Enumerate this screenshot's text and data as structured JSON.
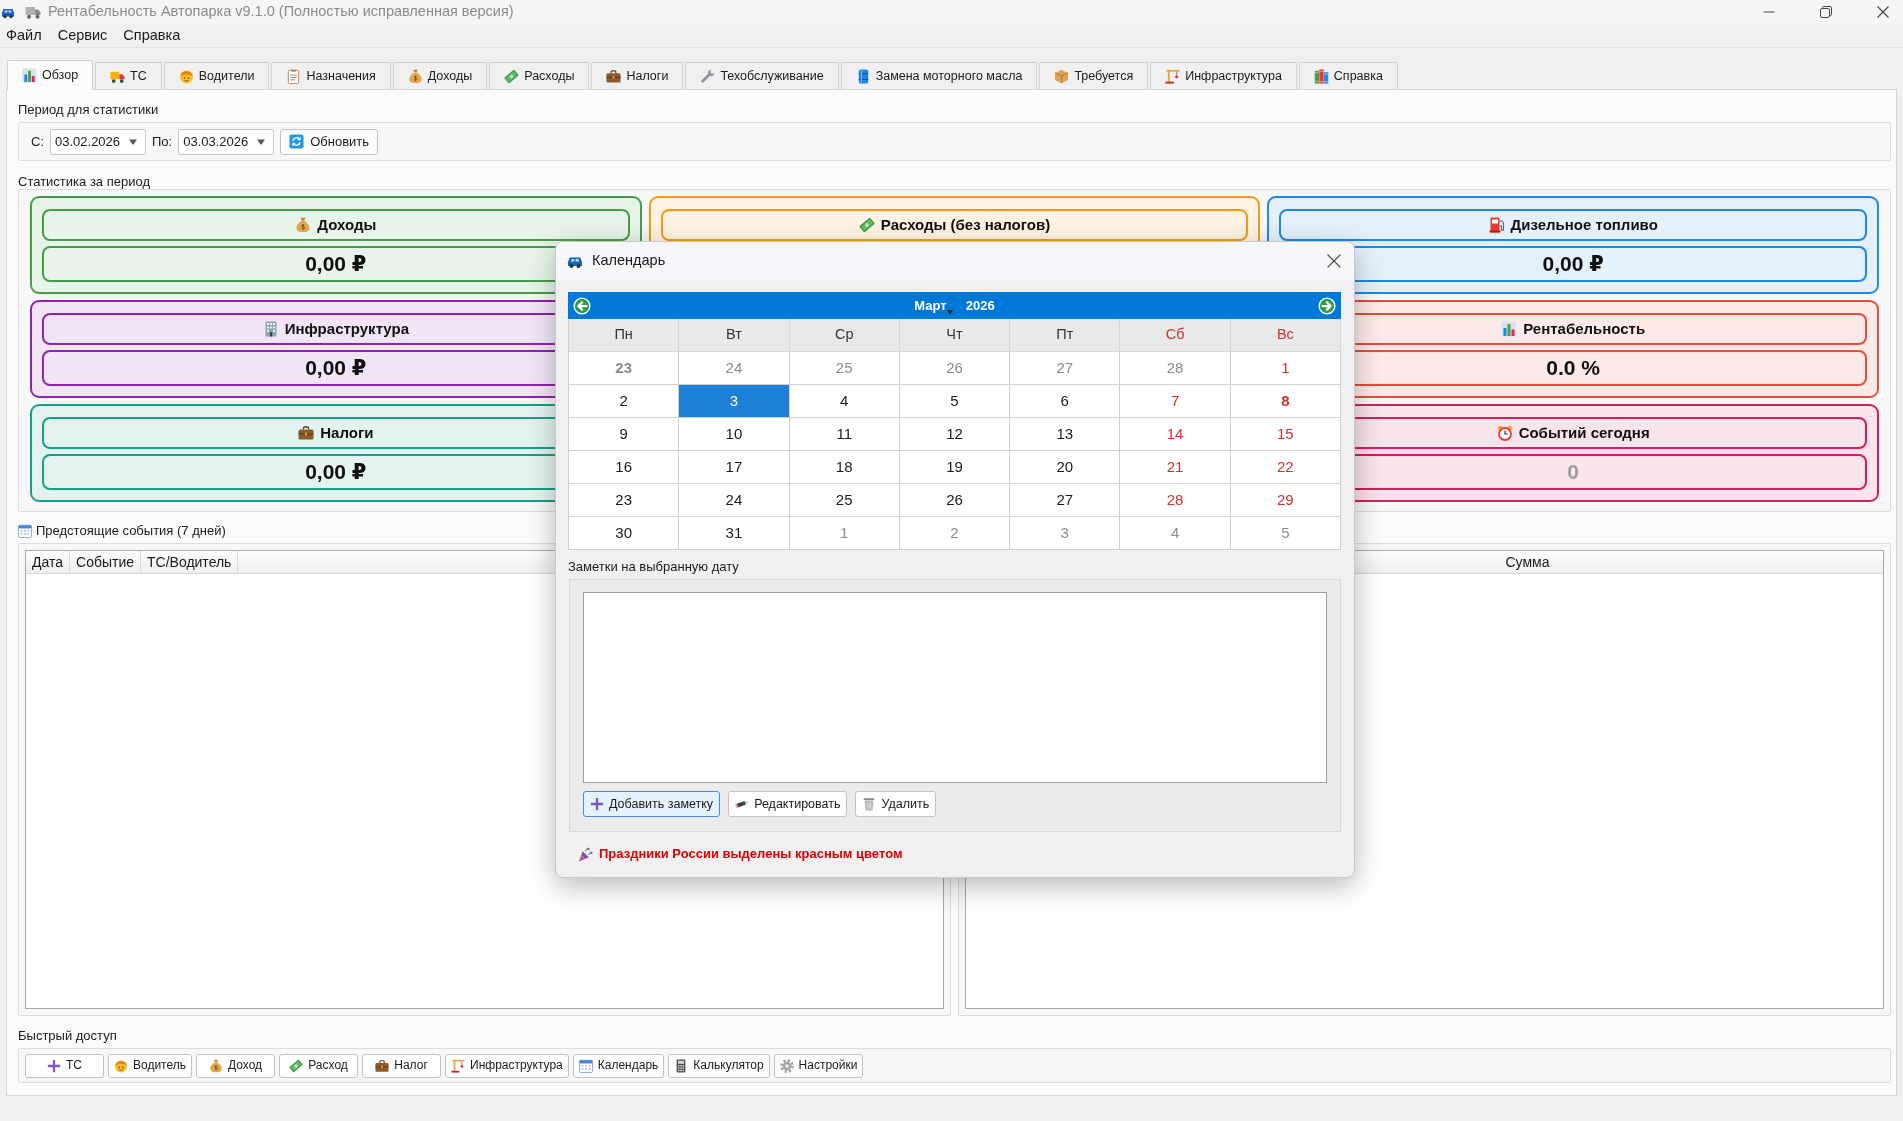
{
  "window": {
    "title": "Рентабельность Автопарка v9.1.0 (Полностью исправленная версия)"
  },
  "menu": [
    "Файл",
    "Сервис",
    "Справка"
  ],
  "tabs": [
    {
      "label": "Обзор",
      "selected": true
    },
    {
      "label": "ТС",
      "selected": false
    },
    {
      "label": "Водители",
      "selected": false
    },
    {
      "label": "Назначения",
      "selected": false
    },
    {
      "label": "Доходы",
      "selected": false
    },
    {
      "label": "Расходы",
      "selected": false
    },
    {
      "label": "Налоги",
      "selected": false
    },
    {
      "label": "Техобслуживание",
      "selected": false
    },
    {
      "label": "Замена моторного масла",
      "selected": false
    },
    {
      "label": "Требуется",
      "selected": false
    },
    {
      "label": "Инфраструктура",
      "selected": false
    },
    {
      "label": "Справка",
      "selected": false
    }
  ],
  "period": {
    "title": "Период для статистики",
    "from_label": "С:",
    "from_value": "03.02.2026",
    "to_label": "По:",
    "to_value": "03.03.2026",
    "refresh_button": "Обновить"
  },
  "stats": {
    "title": "Статистика за период",
    "columns": [
      {
        "cards": [
          {
            "title": "Доходы",
            "value": "0,00 ₽",
            "color": "#43a047",
            "muted": false
          },
          {
            "title": "Инфраструктура",
            "value": "0,00 ₽",
            "color": "#8e24aa",
            "muted": false
          },
          {
            "title": "Налоги",
            "value": "0,00 ₽",
            "color": "#16a085",
            "muted": false
          }
        ]
      },
      {
        "cards": [
          {
            "title": "Расходы (без налогов)",
            "color": "#f39c12"
          }
        ]
      },
      {
        "cards": [
          {
            "title": "Дизельное топливо",
            "value": "0,00 ₽",
            "color": "#1e88e5",
            "muted": false
          },
          {
            "title": "Рентабельность",
            "value": "0.0 %",
            "color": "#e74c3c",
            "muted": false
          },
          {
            "title": "Событий сегодня",
            "value": "0",
            "color": "#d81b60",
            "muted": true
          }
        ]
      }
    ]
  },
  "events": {
    "title": "Предстоящие события (7 дней)",
    "columns": [
      "Дата",
      "Событие",
      "ТС/Водитель"
    ]
  },
  "right_table": {
    "columns": [
      "Сумма"
    ]
  },
  "quick_access": {
    "title": "Быстрый доступ",
    "buttons": [
      "ТС",
      "Водитель",
      "Доход",
      "Расход",
      "Налог",
      "Инфраструктура",
      "Календарь",
      "Калькулятор",
      "Настройки"
    ]
  },
  "calendar_dialog": {
    "title": "Календарь",
    "month": "Март",
    "year": "2026",
    "weekdays": [
      {
        "label": "Пн",
        "weekend": false
      },
      {
        "label": "Вт",
        "weekend": false
      },
      {
        "label": "Ср",
        "weekend": false
      },
      {
        "label": "Чт",
        "weekend": false
      },
      {
        "label": "Пт",
        "weekend": false
      },
      {
        "label": "Сб",
        "weekend": true
      },
      {
        "label": "Вс",
        "weekend": true
      }
    ],
    "weeks": [
      {
        "days": [
          {
            "day": "23",
            "other_month": true,
            "holiday": true,
            "selected": false
          },
          {
            "day": "24",
            "other_month": true,
            "holiday": false,
            "selected": false
          },
          {
            "day": "25",
            "other_month": true,
            "holiday": false,
            "selected": false
          },
          {
            "day": "26",
            "other_month": true,
            "holiday": false,
            "selected": false
          },
          {
            "day": "27",
            "other_month": true,
            "holiday": false,
            "selected": false
          },
          {
            "day": "28",
            "other_month": true,
            "holiday": false,
            "selected": false
          },
          {
            "day": "1",
            "other_month": false,
            "holiday": false,
            "selected": false
          }
        ]
      },
      {
        "days": [
          {
            "day": "2",
            "other_month": false,
            "holiday": false,
            "selected": false
          },
          {
            "day": "3",
            "other_month": false,
            "holiday": false,
            "selected": true
          },
          {
            "day": "4",
            "other_month": false,
            "holiday": false,
            "selected": false
          },
          {
            "day": "5",
            "other_month": false,
            "holiday": false,
            "selected": false
          },
          {
            "day": "6",
            "other_month": false,
            "holiday": false,
            "selected": false
          },
          {
            "day": "7",
            "other_month": false,
            "holiday": false,
            "selected": false
          },
          {
            "day": "8",
            "other_month": false,
            "holiday": true,
            "selected": false
          }
        ]
      },
      {
        "days": [
          {
            "day": "9",
            "other_month": false,
            "holiday": false,
            "selected": false
          },
          {
            "day": "10",
            "other_month": false,
            "holiday": false,
            "selected": false
          },
          {
            "day": "11",
            "other_month": false,
            "holiday": false,
            "selected": false
          },
          {
            "day": "12",
            "other_month": false,
            "holiday": false,
            "selected": false
          },
          {
            "day": "13",
            "other_month": false,
            "holiday": false,
            "selected": false
          },
          {
            "day": "14",
            "other_month": false,
            "holiday": false,
            "selected": false
          },
          {
            "day": "15",
            "other_month": false,
            "holiday": false,
            "selected": false
          }
        ]
      },
      {
        "days": [
          {
            "day": "16",
            "other_month": false,
            "holiday": false,
            "selected": false
          },
          {
            "day": "17",
            "other_month": false,
            "holiday": false,
            "selected": false
          },
          {
            "day": "18",
            "other_month": false,
            "holiday": false,
            "selected": false
          },
          {
            "day": "19",
            "other_month": false,
            "holiday": false,
            "selected": false
          },
          {
            "day": "20",
            "other_month": false,
            "holiday": false,
            "selected": false
          },
          {
            "day": "21",
            "other_month": false,
            "holiday": false,
            "selected": false
          },
          {
            "day": "22",
            "other_month": false,
            "holiday": false,
            "selected": false
          }
        ]
      },
      {
        "days": [
          {
            "day": "23",
            "other_month": false,
            "holiday": false,
            "selected": false
          },
          {
            "day": "24",
            "other_month": false,
            "holiday": false,
            "selected": false
          },
          {
            "day": "25",
            "other_month": false,
            "holiday": false,
            "selected": false
          },
          {
            "day": "26",
            "other_month": false,
            "holiday": false,
            "selected": false
          },
          {
            "day": "27",
            "other_month": false,
            "holiday": false,
            "selected": false
          },
          {
            "day": "28",
            "other_month": false,
            "holiday": false,
            "selected": false
          },
          {
            "day": "29",
            "other_month": false,
            "holiday": false,
            "selected": false
          }
        ]
      },
      {
        "days": [
          {
            "day": "30",
            "other_month": false,
            "holiday": false,
            "selected": false
          },
          {
            "day": "31",
            "other_month": false,
            "holiday": false,
            "selected": false
          },
          {
            "day": "1",
            "other_month": true,
            "holiday": false,
            "selected": false
          },
          {
            "day": "2",
            "other_month": true,
            "holiday": false,
            "selected": false
          },
          {
            "day": "3",
            "other_month": true,
            "holiday": false,
            "selected": false
          },
          {
            "day": "4",
            "other_month": true,
            "holiday": false,
            "selected": false
          },
          {
            "day": "5",
            "other_month": true,
            "holiday": false,
            "selected": false
          }
        ]
      }
    ],
    "notes_title": "Заметки на выбранную дату",
    "buttons": [
      {
        "label": "Добавить заметку",
        "focused": true
      },
      {
        "label": "Редактировать",
        "focused": false
      },
      {
        "label": "Удалить",
        "focused": false
      }
    ],
    "holiday_note": "Праздники России выделены красным цветом"
  }
}
